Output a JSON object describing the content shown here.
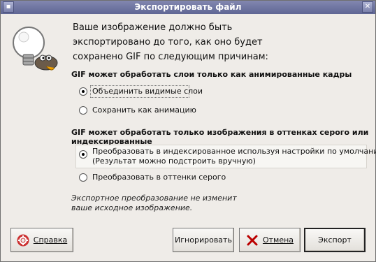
{
  "window": {
    "title": "Экспортировать файл"
  },
  "intro": {
    "lines": [
      "Ваше изображение должно быть",
      "экспортировано до того, как оно будет",
      "сохранено GIF по следующим причинам:"
    ]
  },
  "layers_section": {
    "title": "GIF может обработать слои только как анимированные кадры",
    "options": [
      {
        "label": "Объединить видимые слои",
        "selected": true
      },
      {
        "label": "Сохранить как анимацию",
        "selected": false
      }
    ]
  },
  "color_section": {
    "title": "GIF может обработать только изображения в оттенках серого или индексированные",
    "options": [
      {
        "label_line1": "Преобразовать в индексированное используя настройки по умолчанию",
        "label_line2": "(Результат можно подстроить вручную)",
        "selected": true
      },
      {
        "label": "Преобразовать в оттенки серого",
        "selected": false
      }
    ]
  },
  "note": {
    "line1": "Экспортное преобразование не изменит",
    "line2": "ваше исходное изображение."
  },
  "buttons": {
    "help": {
      "label": "Справка",
      "icon": "lifebuoy-icon"
    },
    "ignore": {
      "label": "Игнорировать"
    },
    "cancel": {
      "label": "Отмена",
      "icon": "x-icon"
    },
    "export": {
      "label": "Экспорт"
    }
  }
}
